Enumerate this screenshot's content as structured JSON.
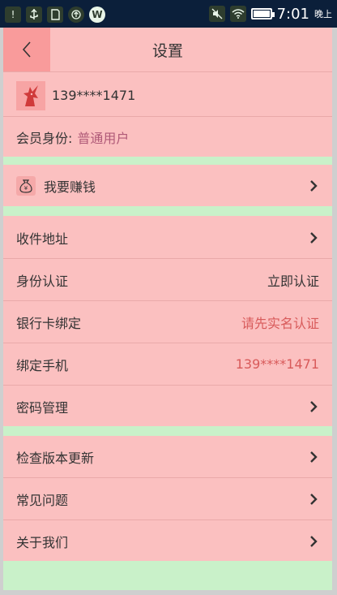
{
  "status_bar": {
    "time": "7:01",
    "period": "晚上",
    "battery_level": 1.0,
    "icons": [
      "notification-icon",
      "usb-icon",
      "sd-card-icon",
      "upload-icon",
      "wechat-icon",
      "mute-icon",
      "wifi-icon",
      "battery-icon"
    ]
  },
  "header": {
    "title": "设置",
    "back_icon": "chevron-left-icon"
  },
  "profile": {
    "phone": "139****1471",
    "member_line": "会员身份:",
    "member_value": "普通用户",
    "avatar_icon": "unicorn-avatar-icon"
  },
  "earn": {
    "label": "我要赚钱",
    "icon": "money-bag-icon"
  },
  "account_items": [
    {
      "label": "收件地址",
      "value": "",
      "chevron": true
    },
    {
      "label": "身份认证",
      "value": "立即认证",
      "chevron": false
    },
    {
      "label": "银行卡绑定",
      "value": "请先实名认证",
      "chevron": false
    },
    {
      "label": "绑定手机",
      "value": "139****1471",
      "chevron": false
    },
    {
      "label": "密码管理",
      "value": "",
      "chevron": true
    }
  ],
  "app_items": [
    {
      "label": "检查版本更新",
      "chevron": true
    },
    {
      "label": "常见问题",
      "chevron": true
    },
    {
      "label": "关于我们",
      "chevron": true
    }
  ],
  "colors": {
    "screen_bg": "#fbc0c0",
    "section_gap": "#c9f1c9",
    "accent_warn": "#d85a5a",
    "status_bar": "#0b1f3a"
  }
}
